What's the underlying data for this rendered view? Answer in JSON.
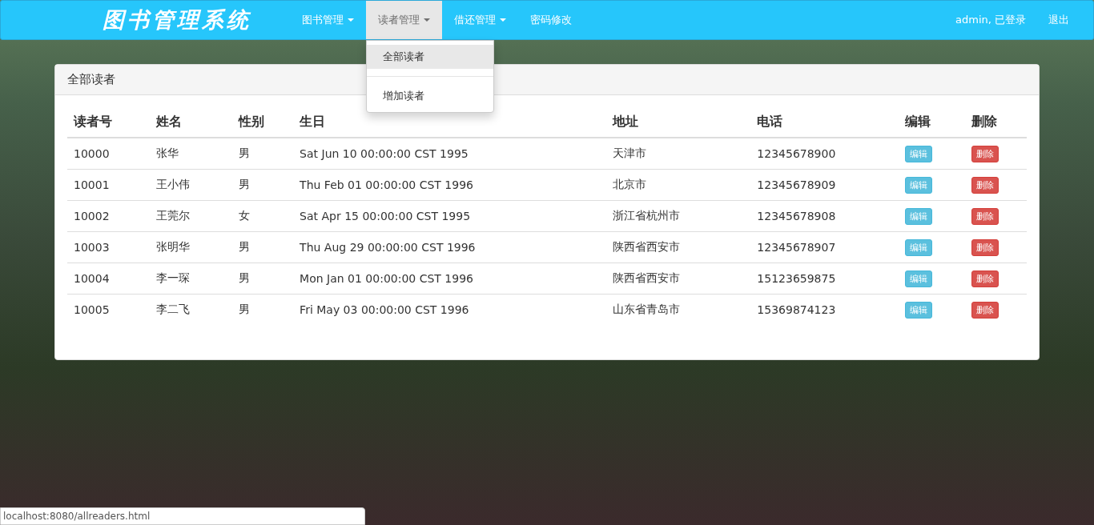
{
  "navbar": {
    "brand": "图书管理系统",
    "items": [
      {
        "label": "图书管理",
        "kind": "dropdown",
        "open": false
      },
      {
        "label": "读者管理",
        "kind": "dropdown",
        "open": true
      },
      {
        "label": "借还管理",
        "kind": "dropdown",
        "open": false
      },
      {
        "label": "密码修改",
        "kind": "link",
        "open": false
      }
    ],
    "dropdown_menu": [
      {
        "label": "全部读者",
        "selected": true
      },
      {
        "label": "增加读者",
        "selected": false
      }
    ],
    "user": "admin, 已登录",
    "logout": "退出"
  },
  "panel": {
    "title": "全部读者",
    "table": {
      "columns": [
        "读者号",
        "姓名",
        "性别",
        "生日",
        "地址",
        "电话",
        "编辑",
        "删除"
      ],
      "rows": [
        [
          "10000",
          "张华",
          "男",
          "Sat Jun 10 00:00:00 CST 1995",
          "天津市",
          "12345678900",
          "编辑",
          "删除"
        ],
        [
          "10001",
          "王小伟",
          "男",
          "Thu Feb 01 00:00:00 CST 1996",
          "北京市",
          "12345678909",
          "编辑",
          "删除"
        ],
        [
          "10002",
          "王莞尔",
          "女",
          "Sat Apr 15 00:00:00 CST 1995",
          "浙江省杭州市",
          "12345678908",
          "编辑",
          "删除"
        ],
        [
          "10003",
          "张明华",
          "男",
          "Thu Aug 29 00:00:00 CST 1996",
          "陕西省西安市",
          "12345678907",
          "编辑",
          "删除"
        ],
        [
          "10004",
          "李一琛",
          "男",
          "Mon Jan 01 00:00:00 CST 1996",
          "陕西省西安市",
          "15123659875",
          "编辑",
          "删除"
        ],
        [
          "10005",
          "李二飞",
          "男",
          "Fri May 03 00:00:00 CST 1996",
          "山东省青岛市",
          "15369874123",
          "编辑",
          "删除"
        ]
      ]
    }
  },
  "status_bar": {
    "url": "localhost:8080/allreaders.html"
  }
}
